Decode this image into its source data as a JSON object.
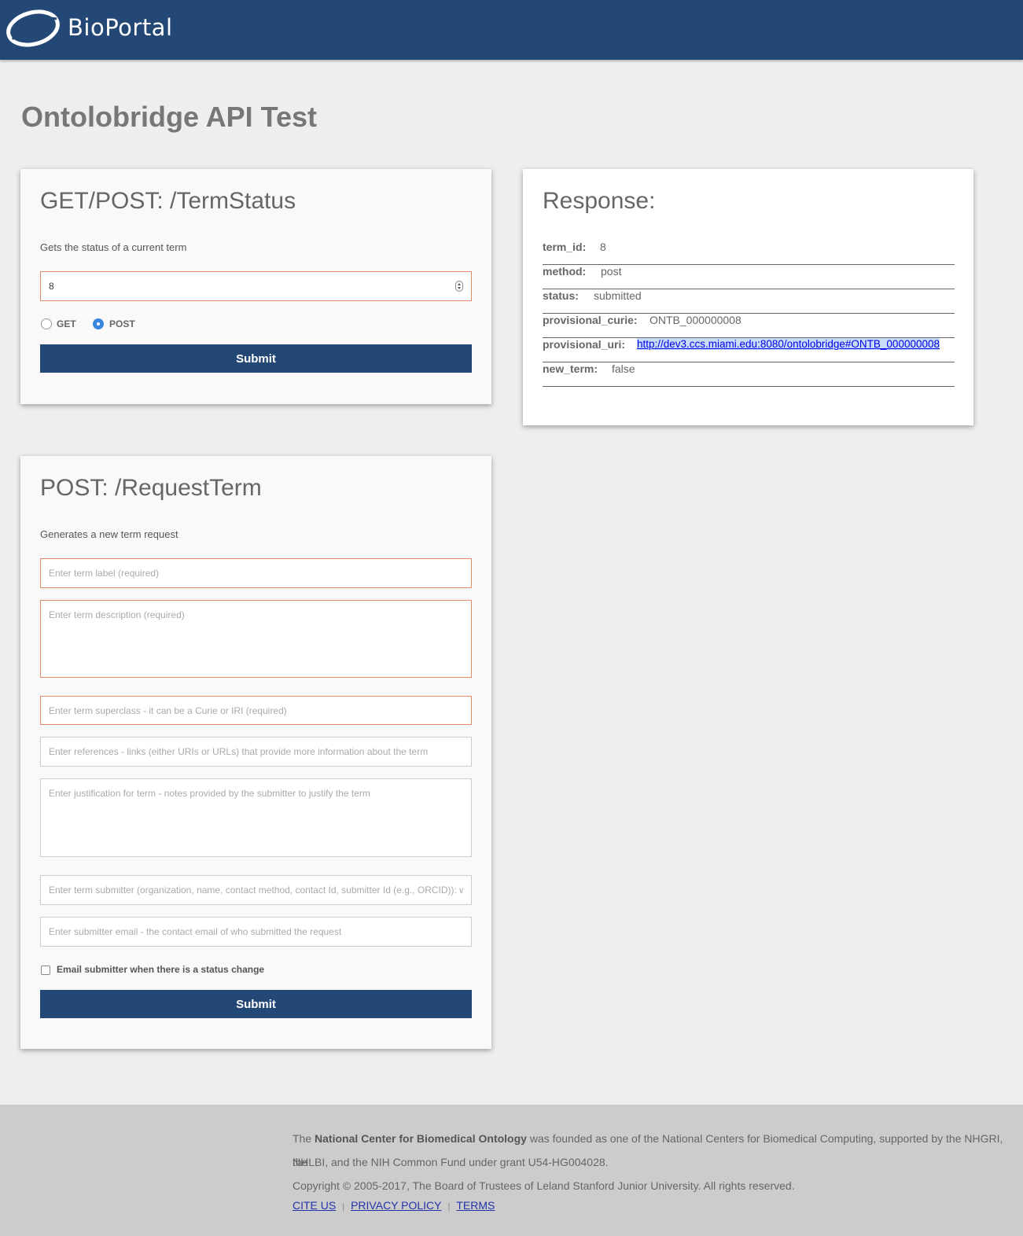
{
  "header": {
    "brand": "BioPortal",
    "logo_icon": "bioportal-orbit-logo"
  },
  "page": {
    "title": "Ontolobridge API Test"
  },
  "term_status": {
    "title": "GET/POST: /TermStatus",
    "description": "Gets the status of a current term",
    "term_id_value": "8",
    "radio_get": "GET",
    "radio_post": "POST",
    "selected_method": "POST",
    "submit_label": "Submit"
  },
  "response": {
    "title": "Response:",
    "rows": [
      {
        "key": "term_id:",
        "value": "8"
      },
      {
        "key": "method:",
        "value": "post"
      },
      {
        "key": "status:",
        "value": "submitted"
      },
      {
        "key": "provisional_curie:",
        "value": "ONTB_000000008"
      },
      {
        "key": "provisional_uri:",
        "value": "http://dev3.ccs.miami.edu:8080/ontolobridge#ONTB_000000008"
      },
      {
        "key": "new_term:",
        "value": "false"
      }
    ]
  },
  "request_term": {
    "title": "POST: /RequestTerm",
    "description": "Generates a new term request",
    "label_placeholder": "Enter term label (required)",
    "description_placeholder": "Enter term description (required)",
    "superclass_placeholder": "Enter term superclass - it can be a Curie or IRI (required)",
    "references_placeholder": "Enter references - links (either URIs or URLs) that provide more information about the term",
    "justification_placeholder": "Enter justification for term - notes provided by the submitter to justify the term",
    "submitter_placeholder": "Enter term submitter (organization, name, contact method, contact Id, submitter Id (e.g., ORCID)): wl",
    "email_placeholder": "Enter submitter email - the contact email of who submitted the request",
    "notify_label": "Email submitter when there is a status change",
    "notify_checked": false,
    "submit_label": "Submit"
  },
  "footer": {
    "text_pre": "The ",
    "text_org": "National Center for Biomedical Ontology",
    "text_post": " was founded as one of the National Centers for Biomedical Computing, supported by the NHGRI, the",
    "text_line2": "NHLBI, and the NIH Common Fund under grant U54-HG004028.",
    "copyright": "Copyright © 2005-2017, The Board of Trustees of Leland Stanford Junior University. All rights reserved.",
    "links": [
      "CITE US",
      "PRIVACY POLICY",
      "TERMS"
    ],
    "separator": "|"
  },
  "colors": {
    "header_bg": "#234876",
    "button_bg": "#234876",
    "required_border": "#e08a6a",
    "radio_accent": "#3a86e0",
    "footer_bg": "#cccccc",
    "page_bg": "#eeeeee"
  }
}
